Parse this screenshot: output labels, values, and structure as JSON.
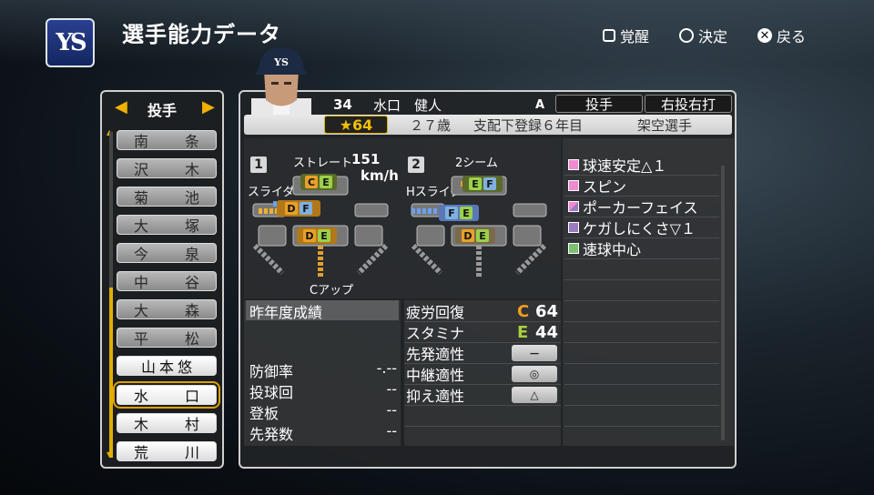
{
  "header": {
    "title": "選手能力データ",
    "logo_text": "YS",
    "guides": [
      {
        "glyph": "□",
        "label": "覚醒"
      },
      {
        "glyph": "○",
        "label": "決定"
      },
      {
        "glyph": "✕",
        "label": "戻る"
      }
    ]
  },
  "list": {
    "category": "投手",
    "players": [
      "南　条",
      "沢　木",
      "菊　池",
      "大　塚",
      "今　泉",
      "中　谷",
      "大　森",
      "平　松",
      "山本悠",
      "水　口",
      "木　村",
      "荒　川"
    ]
  },
  "player": {
    "number": "34",
    "name": "水口　健人",
    "hand_mark": "A",
    "position": "投手",
    "handedness": "右投右打",
    "rating": "★64",
    "age": "２７歳",
    "registration": "支配下登録６年目",
    "type": "架空選手"
  },
  "pitches": {
    "fastball_label": "ストレート",
    "speed": "151",
    "speed_unit": "km/h",
    "second_label": "2シーム",
    "slots": [
      "1",
      "2"
    ],
    "slider1": "スライダー",
    "slider2": "Hスライダー",
    "change": "Cアップ",
    "grades": {
      "slider1": [
        "C",
        "E"
      ],
      "sink1": [
        "D",
        "F"
      ],
      "low1": [
        "D",
        "E"
      ],
      "two_seam": [
        "E",
        "F"
      ],
      "hslider": [
        "F",
        "E"
      ],
      "low2": [
        "D",
        "E"
      ]
    },
    "grade_colors": {
      "C": "#e8a02a",
      "D": "#e8a02a",
      "E": "#9bd04a",
      "F": "#7fb0e0"
    }
  },
  "season": {
    "header": "昨年度成績",
    "rows": [
      {
        "label": "防御率",
        "value": "-.--"
      },
      {
        "label": "投球回",
        "value": "--"
      },
      {
        "label": "登板",
        "value": "--"
      },
      {
        "label": "先発数",
        "value": "--"
      }
    ]
  },
  "attributes": [
    {
      "label": "疲労回復",
      "grade": "C",
      "value": "64",
      "color": "#f0a020"
    },
    {
      "label": "スタミナ",
      "grade": "E",
      "value": "44",
      "color": "#a8d040"
    }
  ],
  "aptitudes": [
    {
      "label": "先発適性",
      "value": "－"
    },
    {
      "label": "中継適性",
      "value": "◎"
    },
    {
      "label": "抑え適性",
      "value": "△"
    }
  ],
  "abilities": [
    {
      "label": "球速安定△１",
      "color": "#f08ad0"
    },
    {
      "label": "スピン",
      "color": "#f08ad0"
    },
    {
      "label": "ポーカーフェイス",
      "color": "#c070d0"
    },
    {
      "label": "ケガしにくさ▽１",
      "color": "#9a7ac0"
    },
    {
      "label": "速球中心",
      "color": "#7cc070"
    }
  ]
}
